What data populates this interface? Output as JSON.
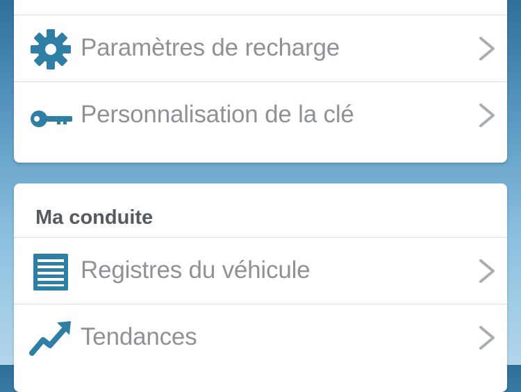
{
  "settings_section": {
    "items": [
      {
        "label": "Paramètres de recharge",
        "icon": "gear-icon"
      },
      {
        "label": "Personnalisation de la clé",
        "icon": "key-icon"
      }
    ]
  },
  "driving_section": {
    "title": "Ma conduite",
    "items": [
      {
        "label": "Registres du véhicule",
        "icon": "list-document-icon"
      },
      {
        "label": "Tendances",
        "icon": "trend-up-icon"
      }
    ]
  },
  "colors": {
    "icon": "#2f7ea6",
    "label": "#8e9297",
    "section_title": "#555a60",
    "chevron": "#a9acb0"
  }
}
